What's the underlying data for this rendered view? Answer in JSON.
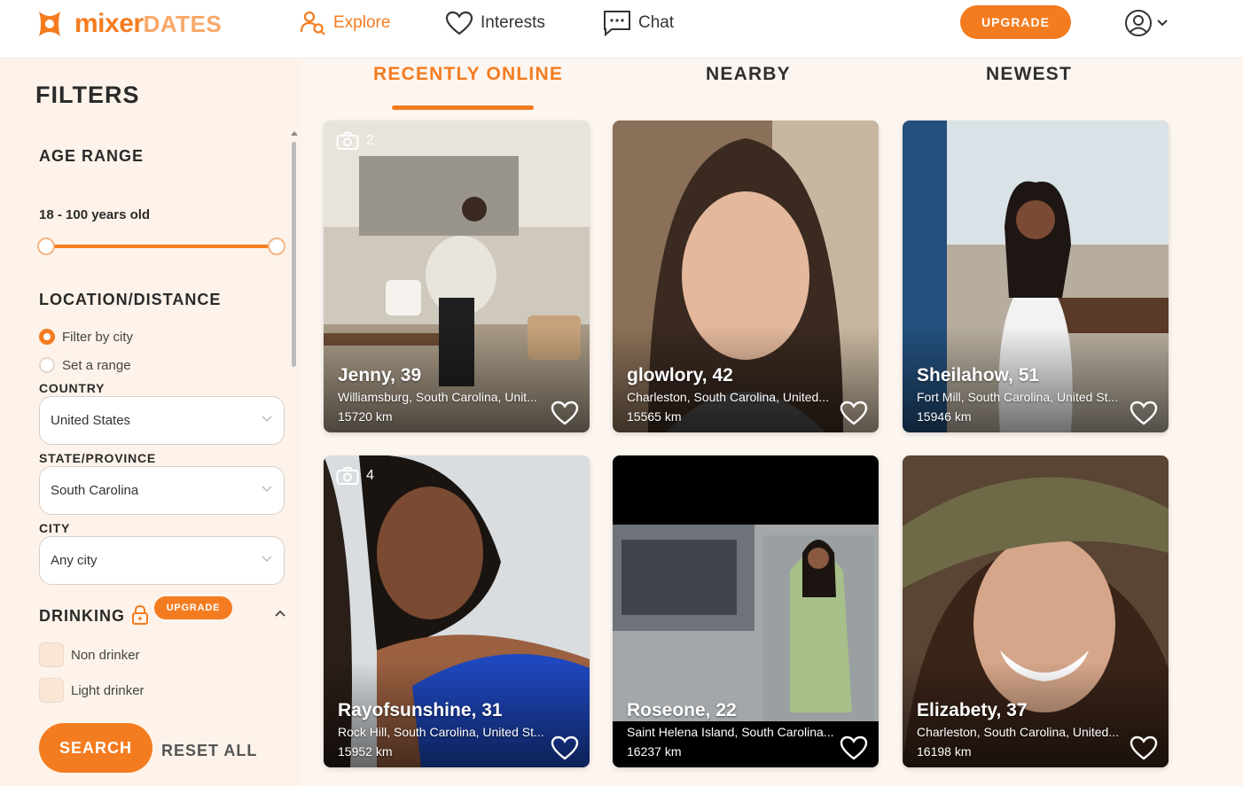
{
  "brand": {
    "name_main": "mixer",
    "name_suffix": "DATES",
    "accent": "#f47c20"
  },
  "nav": {
    "explore": "Explore",
    "interests": "Interests",
    "chat": "Chat",
    "upgrade": "UPGRADE",
    "account_icon": "user-circle-icon"
  },
  "filters": {
    "title": "FILTERS",
    "age": {
      "title": "AGE RANGE",
      "value": "18 - 100 years old",
      "min": 18,
      "max": 100
    },
    "location": {
      "title": "LOCATION/DISTANCE",
      "option_city": "Filter by city",
      "option_range": "Set a range",
      "selected": "Filter by city"
    },
    "country": {
      "label": "COUNTRY",
      "value": "United States"
    },
    "state": {
      "label": "STATE/PROVINCE",
      "value": "South Carolina"
    },
    "city": {
      "label": "CITY",
      "value": "Any city"
    },
    "drinking": {
      "title": "DRINKING",
      "badge": "UPGRADE",
      "options": [
        "Non drinker",
        "Light drinker"
      ]
    },
    "search": "SEARCH",
    "reset": "RESET ALL"
  },
  "tabs": [
    "RECENTLY ONLINE",
    "NEARBY",
    "NEWEST"
  ],
  "active_tab": "RECENTLY ONLINE",
  "profiles": [
    {
      "name": "Jenny, 39",
      "location": "Williamsburg, South Carolina, Unit...",
      "distance": "15720 km",
      "photo_count": "2"
    },
    {
      "name": "glowlory, 42",
      "location": "Charleston, South Carolina, United...",
      "distance": "15565 km",
      "photo_count": ""
    },
    {
      "name": "Sheilahow, 51",
      "location": "Fort Mill, South Carolina, United St...",
      "distance": "15946 km",
      "photo_count": ""
    },
    {
      "name": "Rayofsunshine, 31",
      "location": "Rock Hill, South Carolina, United St...",
      "distance": "15952 km",
      "photo_count": "4"
    },
    {
      "name": "Roseone, 22",
      "location": "Saint Helena Island, South Carolina...",
      "distance": "16237 km",
      "photo_count": ""
    },
    {
      "name": "Elizabety, 37",
      "location": "Charleston, South Carolina, United...",
      "distance": "16198 km",
      "photo_count": ""
    }
  ]
}
